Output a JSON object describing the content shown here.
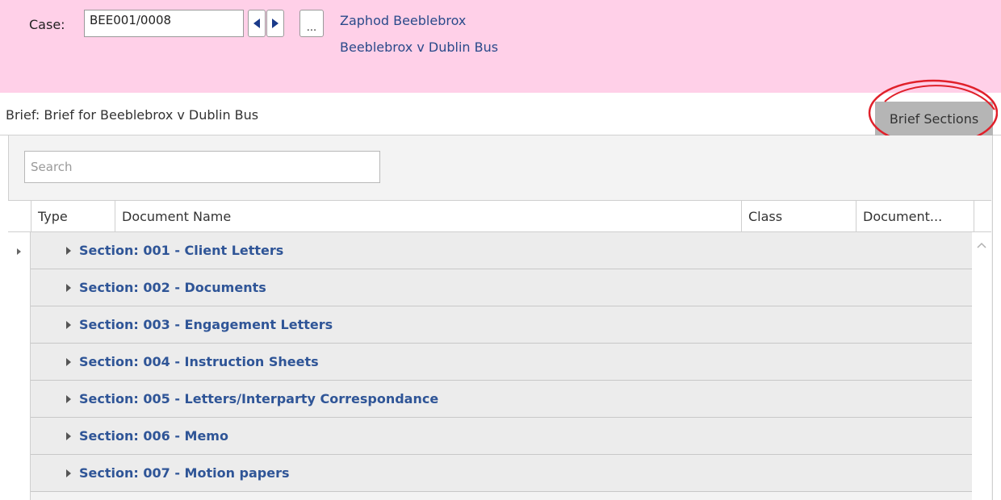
{
  "case": {
    "label": "Case:",
    "number": "BEE001/0008",
    "more_label": "...",
    "client_name": "Zaphod Beeblebrox",
    "matter_description": "Beeblebrox v Dublin Bus"
  },
  "brief": {
    "title": "Brief: Brief for Beeblebrox v Dublin Bus",
    "sections_button": "Brief Sections"
  },
  "search": {
    "placeholder": "Search"
  },
  "columns": [
    "Type",
    "Document Name",
    "Class",
    "Document..."
  ],
  "groups": [
    "Section: 001 - Client Letters",
    "Section: 002 - Documents",
    "Section: 003 - Engagement Letters",
    "Section: 004 - Instruction Sheets",
    "Section: 005 - Letters/Interparty Correspondance",
    "Section: 006 - Memo",
    "Section: 007 - Motion papers"
  ],
  "colors": {
    "case_panel_bg": "#ffd0e8",
    "group_label": "#2f5597",
    "highlight_ellipse": "#e0202a",
    "sections_button_bg": "#b5b5b5"
  },
  "icons": [
    "prev-arrow-icon",
    "next-arrow-icon",
    "expand-arrow-icon",
    "row-indicator-icon",
    "scroll-up-icon"
  ]
}
